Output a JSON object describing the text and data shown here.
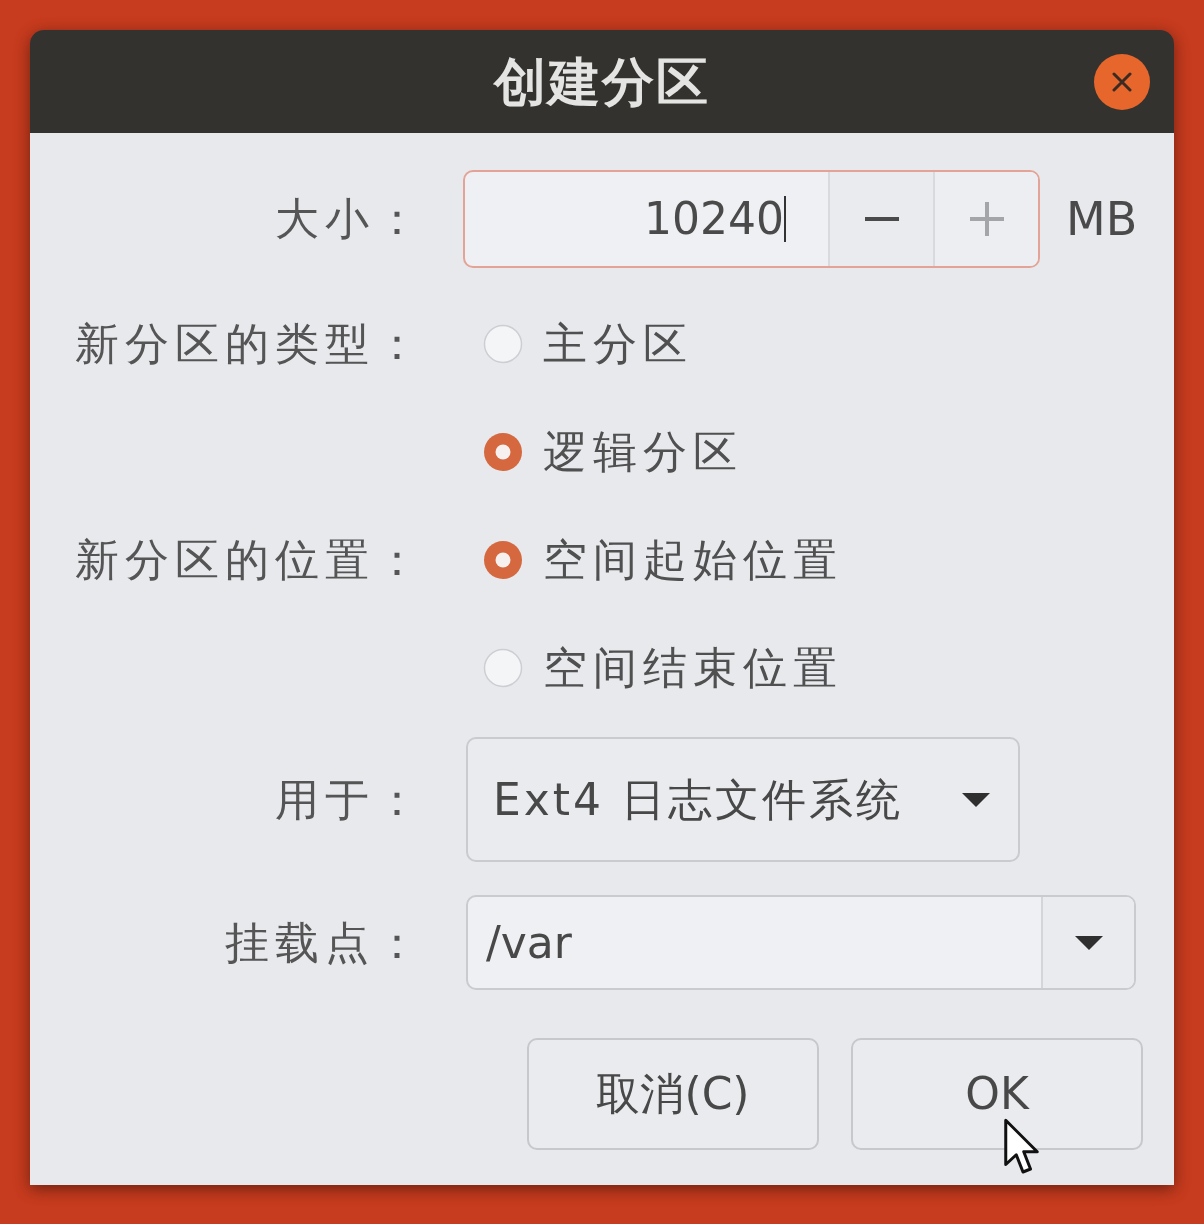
{
  "window": {
    "title": "创建分区"
  },
  "size": {
    "label": "大小：",
    "value": "10240",
    "focused": true,
    "spin_buttons": [
      {
        "kind": "decrement",
        "disabled": false
      },
      {
        "kind": "increment",
        "disabled": true
      }
    ],
    "unit": "MB"
  },
  "partition_type": {
    "label": "新分区的类型：",
    "options": [
      {
        "label": "主分区",
        "selected": false
      },
      {
        "label": "逻辑分区",
        "selected": true
      }
    ]
  },
  "location": {
    "label": "新分区的位置：",
    "options": [
      {
        "label": "空间起始位置",
        "selected": true
      },
      {
        "label": "空间结束位置",
        "selected": false
      }
    ]
  },
  "use_as": {
    "label": "用于：",
    "value": "Ext4 日志文件系统"
  },
  "mount_point": {
    "label": "挂载点：",
    "value": "/var"
  },
  "buttons": [
    {
      "label": "取消(C)"
    },
    {
      "label": "OK"
    }
  ]
}
